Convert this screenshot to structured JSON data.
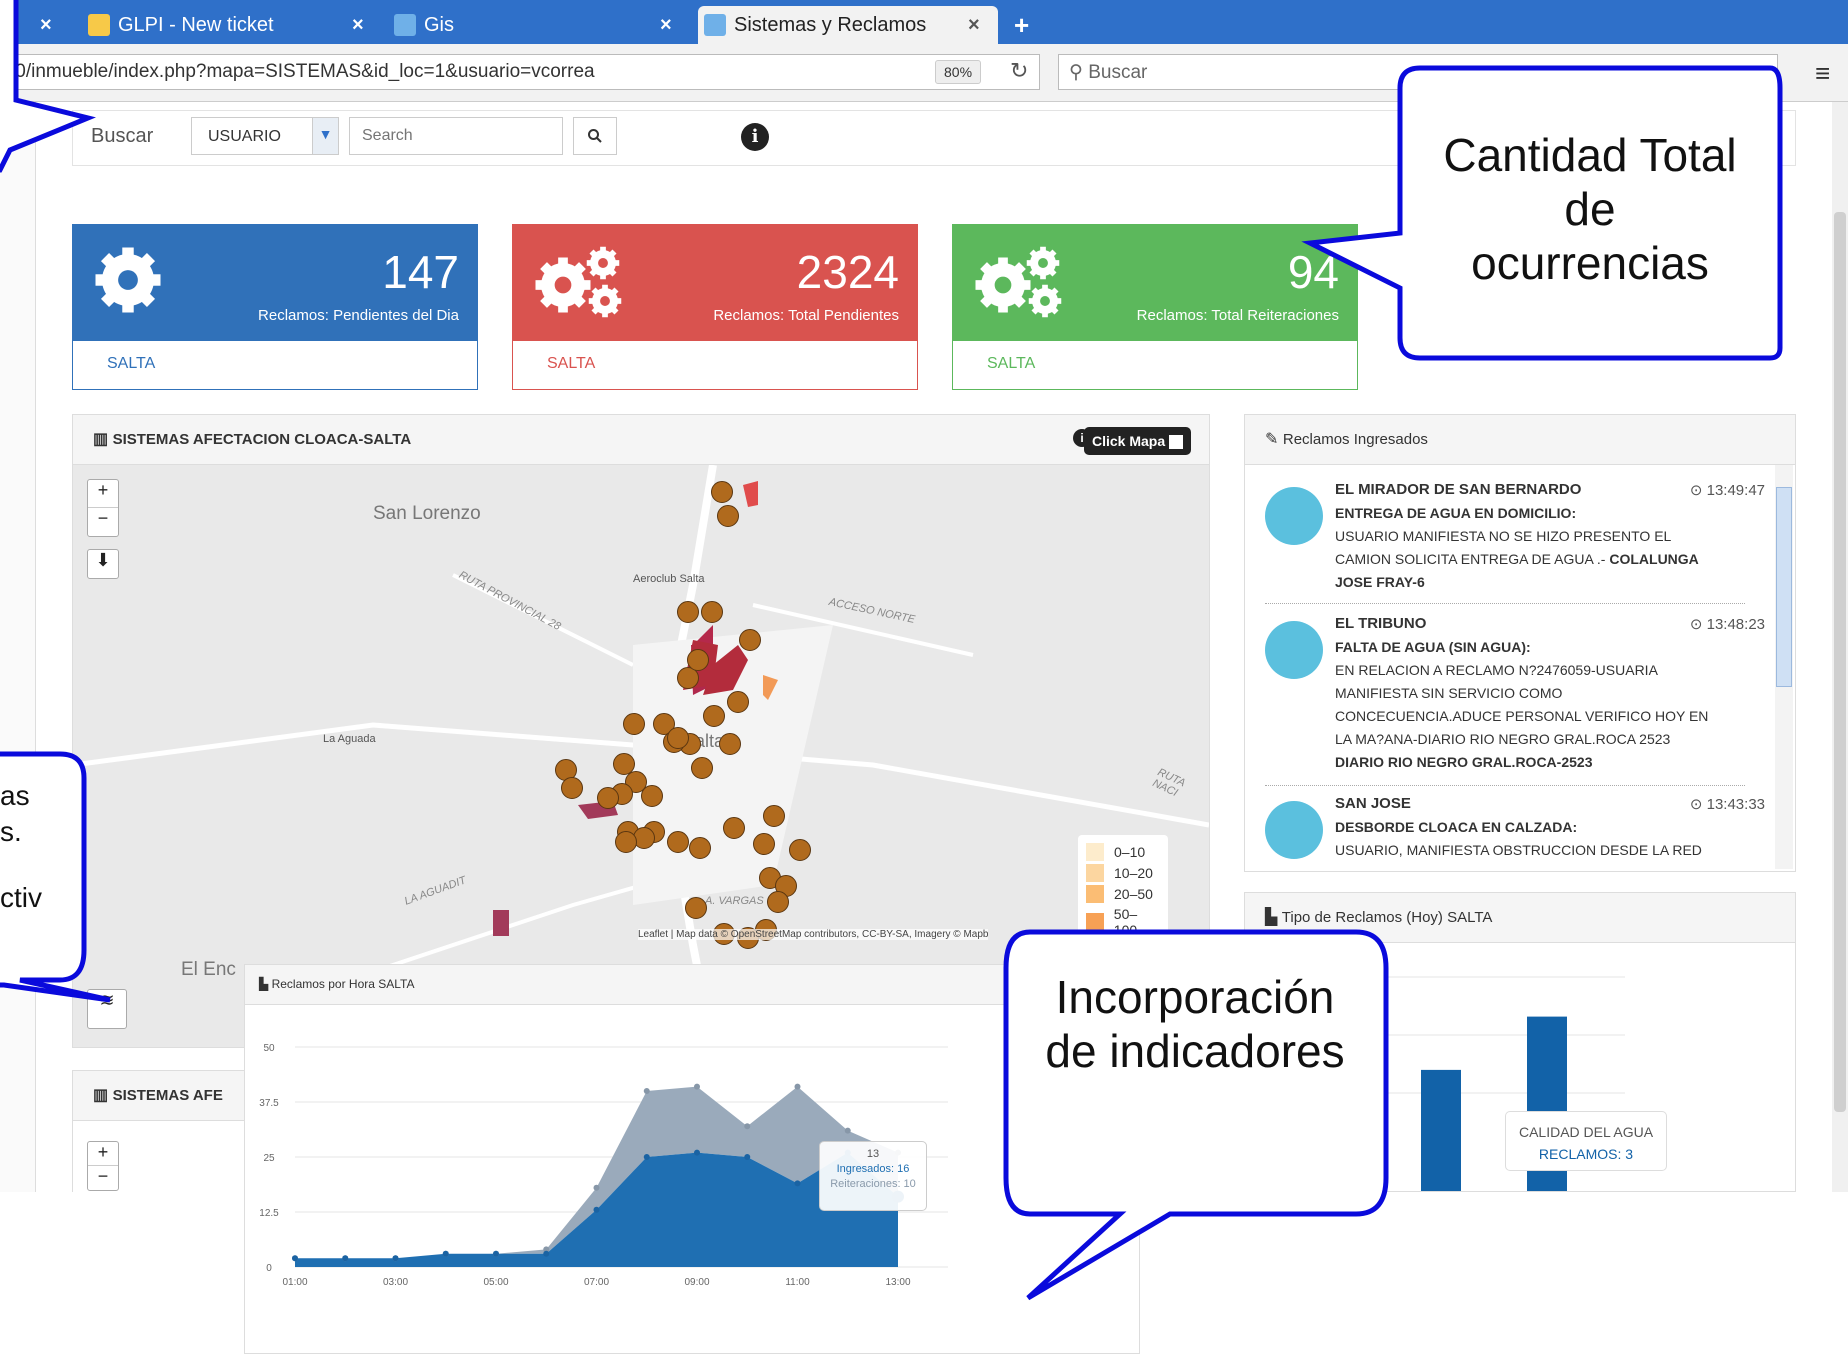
{
  "browser": {
    "tabs": [
      {
        "label": "GLPI - New ticket"
      },
      {
        "label": "Gis"
      },
      {
        "label": "Sistemas y Reclamos"
      }
    ],
    "url": ".0/inmueble/index.php?mapa=SISTEMAS&id_loc=1&usuario=vcorrea",
    "zoom": "80%",
    "search_placeholder": "Buscar"
  },
  "search_row": {
    "label": "Buscar",
    "select_value": "USUARIO",
    "input_placeholder": "Search"
  },
  "kpis": [
    {
      "value": "147",
      "caption": "Reclamos: Pendientes del Dia",
      "footer": "SALTA",
      "color": "#3071b9"
    },
    {
      "value": "2324",
      "caption": "Reclamos: Total Pendientes",
      "footer": "SALTA",
      "color": "#d9534f"
    },
    {
      "value": "94",
      "caption": "Reclamos: Total Reiteraciones",
      "footer": "SALTA",
      "color": "#5cb85c"
    }
  ],
  "map_panel": {
    "title": "SISTEMAS AFECTACION CLOACA-SALTA",
    "click_mapa": "Click Mapa",
    "places": {
      "san_lorenzo": "San Lorenzo",
      "aeroclub": "Aeroclub Salta",
      "la_aguada": "La Aguada",
      "salta": "Salta",
      "el_enc": "El Enc"
    },
    "roads": {
      "ruta_prov": "RUTA PROVINCIAL 28",
      "acceso_norte": "ACCESO NORTE",
      "ruta_nac": "RUTA NACI",
      "aguadit": "LA AGUADIT",
      "vargas": "A. VARGAS"
    },
    "legend": [
      "0–10",
      "10–20",
      "20–50",
      "50–100"
    ],
    "attribution": "Leaflet | Map data © OpenStreetMap contributors, CC-BY-SA, Imagery © Mapb"
  },
  "second_panel": {
    "title": "SISTEMAS AFE"
  },
  "reclamos": {
    "title": "Reclamos Ingresados",
    "items": [
      {
        "title": "EL MIRADOR DE SAN BERNARDO",
        "time": "13:49:47",
        "type": "ENTREGA DE AGUA EN DOMICILIO:",
        "lines": [
          "USUARIO MANIFIESTA NO SE HIZO PRESENTO EL",
          "CAMION SOLICITA ENTREGA DE AGUA .-"
        ],
        "inline_bold": "COLALUNGA",
        "author": "JOSE FRAY-6"
      },
      {
        "title": "EL TRIBUNO",
        "time": "13:48:23",
        "type": "FALTA DE AGUA (SIN AGUA):",
        "lines": [
          "EN RELACION A RECLAMO N?2476059-USUARIA",
          "MANIFIESTA SIN SERVICIO COMO",
          "CONCECUENCIA.ADUCE PERSONAL VERIFICO HOY EN",
          "LA MA?ANA-DIARIO RIO NEGRO GRAL.ROCA 2523"
        ],
        "author": "DIARIO RIO NEGRO GRAL.ROCA-2523"
      },
      {
        "title": "SAN JOSE",
        "time": "13:43:33",
        "type": "DESBORDE CLOACA EN CALZADA:",
        "lines": [
          "USUARIO, MANIFIESTA OBSTRUCCION DESDE LA RED"
        ]
      }
    ]
  },
  "tipo_panel": {
    "title": "Tipo de Reclamos (Hoy) SALTA",
    "tooltip_title": "CALIDAD DEL AGUA",
    "tooltip_value": "RECLAMOS: 3"
  },
  "hour_panel": {
    "title": "Reclamos por Hora SALTA",
    "tooltip_hour": "13",
    "tooltip_ingresados": "Ingresados: 16",
    "tooltip_reiteraciones": "Reiteraciones: 10"
  },
  "callouts": {
    "total": "Cantidad Total de ocurrencias",
    "indicadores": "Incorporación de indicadores",
    "left_partial": [
      "as",
      "s.",
      "",
      "ctiv"
    ]
  },
  "chart_data": [
    {
      "type": "area",
      "title": "Reclamos por Hora SALTA",
      "x": [
        "01:00",
        "02:00",
        "03:00",
        "04:00",
        "05:00",
        "06:00",
        "07:00",
        "08:00",
        "09:00",
        "10:00",
        "11:00",
        "12:00",
        "13:00"
      ],
      "x_tick_labels": [
        "01:00",
        "03:00",
        "05:00",
        "07:00",
        "09:00",
        "11:00",
        "13:00"
      ],
      "y_tick_labels": [
        "0",
        "12.5",
        "25",
        "37.5",
        "50"
      ],
      "ylim": [
        0,
        50
      ],
      "stacked": true,
      "series": [
        {
          "name": "Ingresados",
          "values": [
            2,
            2,
            2,
            3,
            3,
            3,
            13,
            25,
            26,
            25,
            19,
            26,
            16
          ],
          "color": "#1f6fb2"
        },
        {
          "name": "Reiteraciones",
          "values": [
            0,
            0,
            0,
            0,
            0,
            1,
            5,
            15,
            15,
            7,
            22,
            5,
            10
          ],
          "color": "#9aaabb"
        }
      ]
    },
    {
      "type": "bar",
      "title": "Tipo de Reclamos (Hoy) SALTA",
      "values": [
        3,
        25,
        36
      ],
      "ylim": [
        0,
        45
      ],
      "color": "#1262a8"
    }
  ]
}
